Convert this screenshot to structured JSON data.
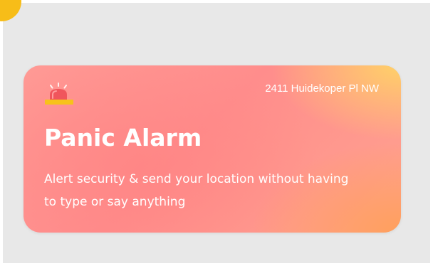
{
  "card": {
    "address": "2411 Huidekoper Pl NW",
    "title": "Panic Alarm",
    "description": "Alert security & send your location without having to type or say anything",
    "icon": "alarm-siren-icon"
  },
  "colors": {
    "card_gradient": [
      "#ff8d8c",
      "#ffa38f",
      "#ffd466",
      "#ffa05a"
    ],
    "siren_red": "#f0555c",
    "siren_base": "#f7c21a",
    "corner_dot": "#f7bd18",
    "backdrop": "#e8e8e8",
    "text": "#ffffff"
  }
}
